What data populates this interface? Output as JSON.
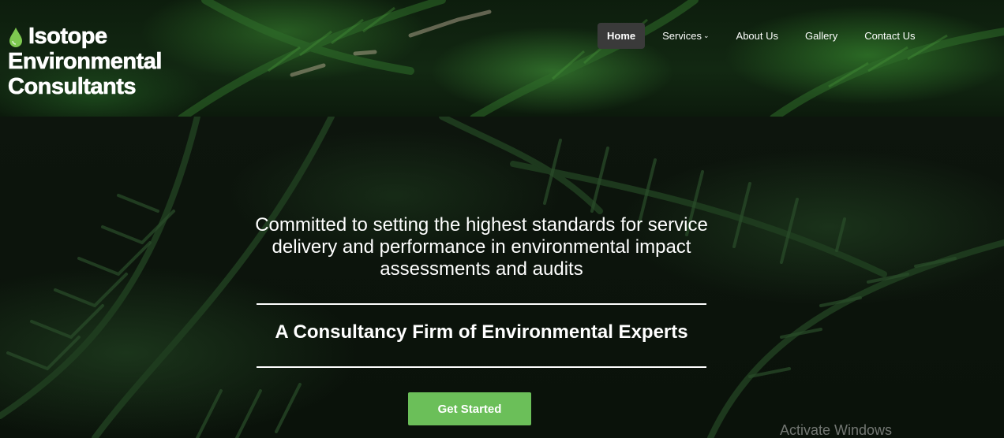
{
  "header": {
    "brand": {
      "icon": "water-drop-icon",
      "name_line1": "Isotope",
      "name_line2": "Environmental",
      "name_line3": "Consultants"
    },
    "nav": [
      {
        "label": "Home",
        "active": true
      },
      {
        "label": "Services",
        "has_dropdown": true,
        "icon": "chevron-down-icon"
      },
      {
        "label": "About Us"
      },
      {
        "label": "Gallery"
      },
      {
        "label": "Contact Us"
      }
    ]
  },
  "hero": {
    "tagline": "Committed to setting the highest standards for service delivery and performance in environmental impact assessments and audits",
    "subtitle": "A Consultancy Firm of Environmental Experts",
    "cta_label": "Get Started"
  },
  "watermark": "Activate Windows",
  "colors": {
    "accent": "#6bbf59",
    "nav_active_bg": "#3a3a3a",
    "drop_icon": "#7ec850"
  }
}
